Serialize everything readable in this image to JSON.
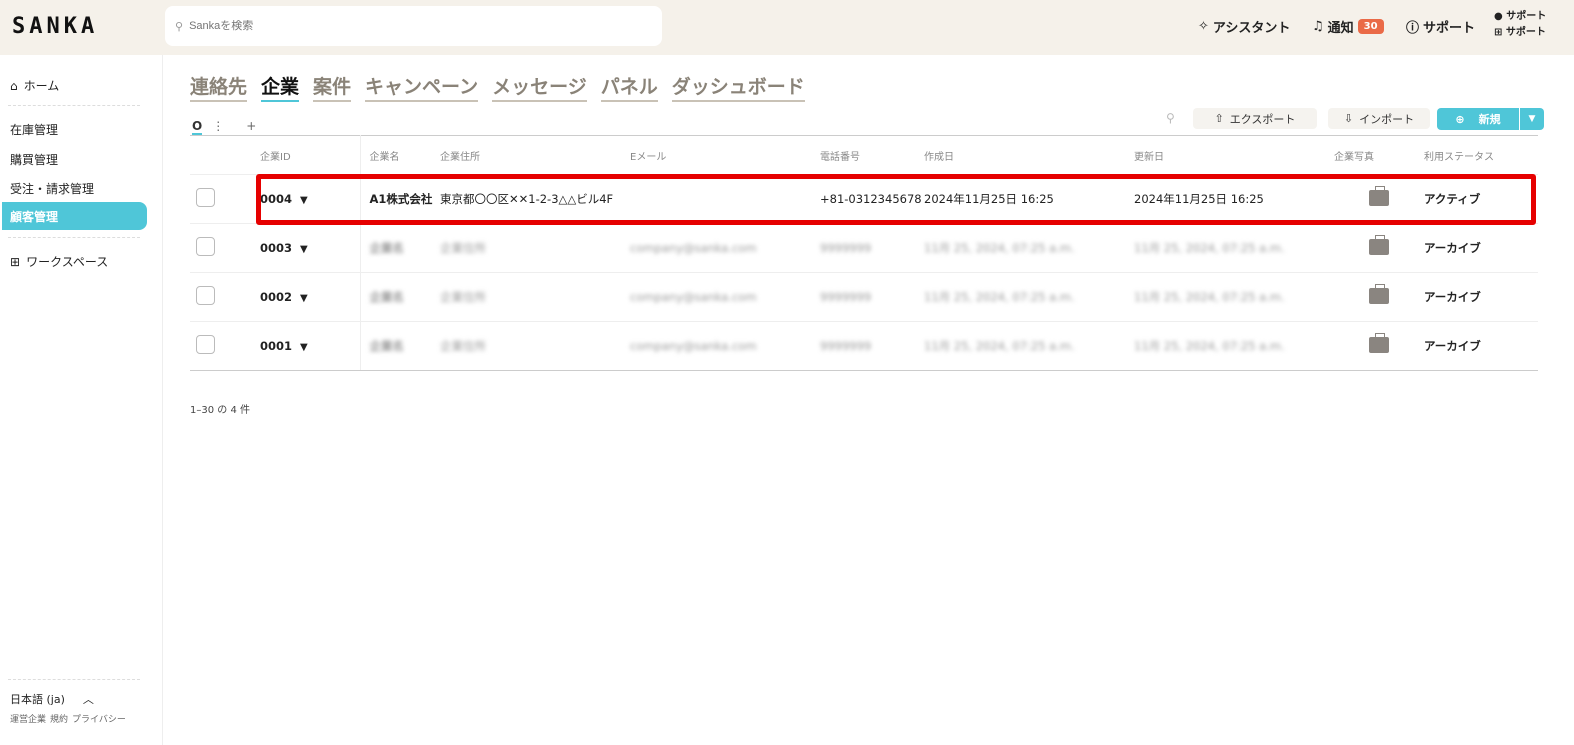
{
  "header": {
    "logo": "SANKA",
    "search_placeholder": "Sankaを検索",
    "assistant": "アシスタント",
    "notifications": "通知",
    "notification_count": "30",
    "support": "サポート",
    "user_line1": "サポート",
    "user_line2": "サポート"
  },
  "sidebar": {
    "home": "ホーム",
    "items": [
      "在庫管理",
      "購買管理",
      "受注・請求管理",
      "顧客管理"
    ],
    "workspace": "ワークスペース",
    "language": "日本語 (ja)",
    "footer_links": [
      "運営企業",
      "規約",
      "プライバシー"
    ]
  },
  "tabs": [
    "連絡先",
    "企業",
    "案件",
    "キャンペーン",
    "メッセージ",
    "パネル",
    "ダッシュボード"
  ],
  "toolbar": {
    "export": "エクスポート",
    "import": "インポート",
    "new": "新規"
  },
  "table": {
    "headers": [
      "企業ID",
      "企業名",
      "企業住所",
      "Eメール",
      "電話番号",
      "作成日",
      "更新日",
      "企業写真",
      "利用ステータス"
    ],
    "rows": [
      {
        "id": "0004",
        "name": "A1株式会社",
        "address": "東京都〇〇区✕✕1-2-3△△ビル4F",
        "email": "",
        "phone": "+81-0312345678",
        "created": "2024年11月25日 16:25",
        "updated": "2024年11月25日 16:25",
        "status": "アクティブ"
      },
      {
        "id": "0003",
        "name": "企業名",
        "address": "企業住所",
        "email": "company@sanka.com",
        "phone": "9999999",
        "created": "11月 25, 2024, 07:25 a.m.",
        "updated": "11月 25, 2024, 07:25 a.m.",
        "status": "アーカイブ"
      },
      {
        "id": "0002",
        "name": "企業名",
        "address": "企業住所",
        "email": "company@sanka.com",
        "phone": "9999999",
        "created": "11月 25, 2024, 07:25 a.m.",
        "updated": "11月 25, 2024, 07:25 a.m.",
        "status": "アーカイブ"
      },
      {
        "id": "0001",
        "name": "企業名",
        "address": "企業住所",
        "email": "company@sanka.com",
        "phone": "9999999",
        "created": "11月 25, 2024, 07:25 a.m.",
        "updated": "11月 25, 2024, 07:25 a.m.",
        "status": "アーカイブ"
      }
    ]
  },
  "pagination": "1–30 の 4 件"
}
